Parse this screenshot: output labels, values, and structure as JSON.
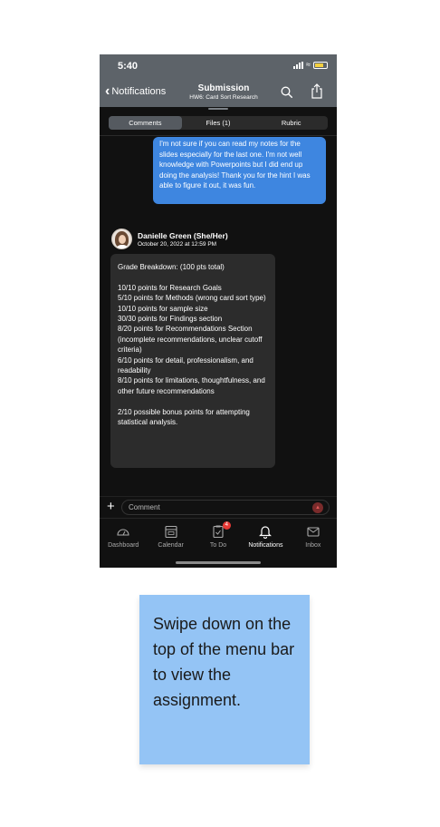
{
  "status_bar": {
    "time": "5:40"
  },
  "nav": {
    "back_label": "Notifications",
    "title": "Submission",
    "subtitle": "HW6: Card Sort Research"
  },
  "tabs": [
    {
      "label": "Comments",
      "active": true
    },
    {
      "label": "Files (1)",
      "active": false
    },
    {
      "label": "Rubric",
      "active": false
    }
  ],
  "student_message": "I'm not sure if you can read my notes for the slides especially for the last one. I'm not well knowledge with Powerpoints but I did end up doing the analysis! Thank you for the hint I was able to figure it out, it was fun.",
  "instructor": {
    "name": "Danielle Green (She/Her)",
    "date": "October 20, 2022 at 12:59 PM",
    "message": "Grade Breakdown: (100 pts total)\n\n10/10 points for Research Goals\n5/10 points for Methods (wrong card sort type)\n10/10 points for sample size\n30/30 points for Findings section\n8/20 points for Recommendations Section (incomplete recommendations, unclear cutoff criteria)\n6/10 points for detail, professionalism, and readability\n8/10 points for limitations, thoughtfulness, and other future recommendations\n\n2/10 possible bonus points for attempting statistical analysis."
  },
  "comment_input": {
    "placeholder": "Comment"
  },
  "tab_bar": {
    "items": [
      {
        "label": "Dashboard",
        "icon": "dashboard-icon"
      },
      {
        "label": "Calendar",
        "icon": "calendar-icon"
      },
      {
        "label": "To Do",
        "icon": "todo-icon",
        "badge": "4"
      },
      {
        "label": "Notifications",
        "icon": "bell-icon",
        "active": true
      },
      {
        "label": "Inbox",
        "icon": "inbox-icon"
      }
    ]
  },
  "sticky_note": {
    "text": "Swipe down on the top of the menu bar to view the assignment."
  },
  "colors": {
    "nav_bg": "#5d6369",
    "outgoing_bubble": "#3e86e0",
    "incoming_bubble": "#2c2c2c",
    "badge": "#e53935",
    "sticky_note": "#94c4f5"
  }
}
